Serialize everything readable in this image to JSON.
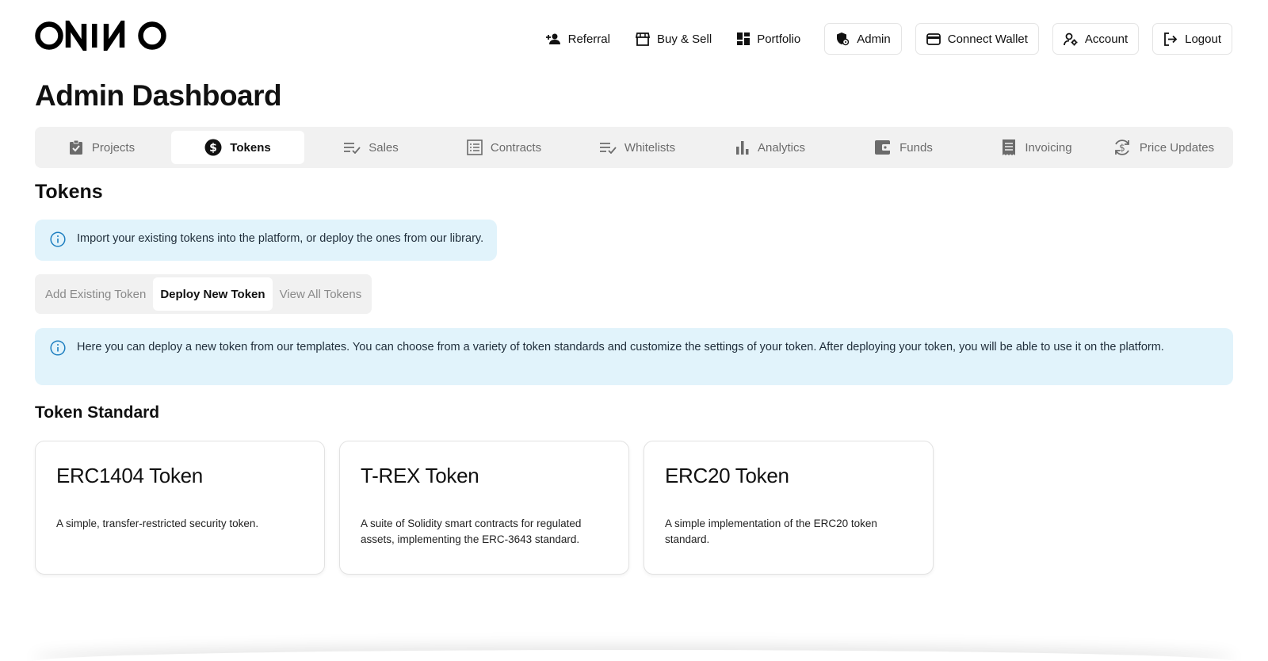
{
  "brand": {
    "logo_text": "ONINO"
  },
  "nav": {
    "links": [
      {
        "label": "Referral",
        "icon": "person-add-icon"
      },
      {
        "label": "Buy & Sell",
        "icon": "store-icon"
      },
      {
        "label": "Portfolio",
        "icon": "dashboard-icon"
      }
    ],
    "buttons": [
      {
        "label": "Admin",
        "icon": "admin-shield-icon"
      },
      {
        "label": "Connect Wallet",
        "icon": "wallet-icon"
      },
      {
        "label": "Account",
        "icon": "account-settings-icon"
      },
      {
        "label": "Logout",
        "icon": "logout-icon"
      }
    ]
  },
  "page": {
    "title": "Admin Dashboard"
  },
  "tabs": [
    {
      "label": "Projects",
      "icon": "clipboard-check-icon",
      "active": false
    },
    {
      "label": "Tokens",
      "icon": "dollar-coin-icon",
      "active": true
    },
    {
      "label": "Sales",
      "icon": "list-check-icon",
      "active": false
    },
    {
      "label": "Contracts",
      "icon": "document-list-icon",
      "active": false
    },
    {
      "label": "Whitelists",
      "icon": "list-check-icon",
      "active": false
    },
    {
      "label": "Analytics",
      "icon": "bar-chart-icon",
      "active": false
    },
    {
      "label": "Funds",
      "icon": "wallet-icon",
      "active": false
    },
    {
      "label": "Invoicing",
      "icon": "receipt-icon",
      "active": false
    },
    {
      "label": "Price Updates",
      "icon": "price-refresh-icon",
      "active": false
    }
  ],
  "tokens": {
    "title": "Tokens",
    "info": "Import your existing tokens into the platform, or deploy the ones from our library.",
    "segments": [
      {
        "label": "Add Existing Token",
        "active": false
      },
      {
        "label": "Deploy New Token",
        "active": true
      },
      {
        "label": "View All Tokens",
        "active": false
      }
    ],
    "deploy_info": "Here you can deploy a new token from our templates. You can choose from a variety of token standards and customize the settings of your token. After deploying your token, you will be able to use it on the platform.",
    "standard_heading": "Token Standard",
    "cards": [
      {
        "title": "ERC1404 Token",
        "description": "A simple, transfer-restricted security token."
      },
      {
        "title": "T-REX Token",
        "description": "A suite of Solidity smart contracts for regulated assets, implementing the ERC-3643 standard."
      },
      {
        "title": "ERC20 Token",
        "description": "A simple implementation of the ERC20 token standard."
      }
    ]
  },
  "colors": {
    "info_bg": "#e1f3fb",
    "info_icon": "#1e7fc0",
    "tabbar_bg": "#f1f1f1",
    "text": "#111111"
  }
}
